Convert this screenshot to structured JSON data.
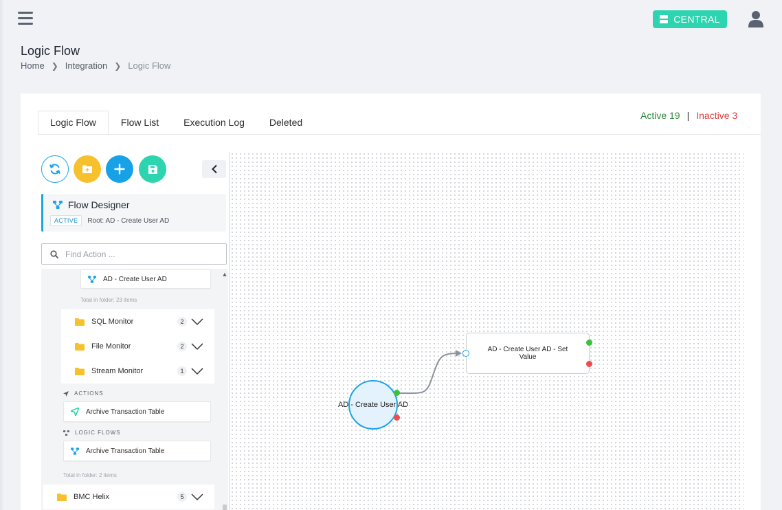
{
  "topbar": {
    "menu_icon": "hamburger-icon",
    "central_label": "CENTRAL",
    "central_icon": "server-icon",
    "user_icon": "user-icon"
  },
  "page": {
    "title": "Logic Flow",
    "breadcrumb": [
      "Home",
      "Integration",
      "Logic Flow"
    ]
  },
  "tabs": [
    {
      "label": "Logic Flow",
      "active": true
    },
    {
      "label": "Flow List",
      "active": false
    },
    {
      "label": "Execution Log",
      "active": false
    },
    {
      "label": "Deleted",
      "active": false
    }
  ],
  "status": {
    "active": "Active 19",
    "separator": "|",
    "inactive": "Inactive 3"
  },
  "toolbar": {
    "icons": [
      "refresh-icon",
      "folder-plus-icon",
      "plus-icon",
      "save-icon"
    ],
    "collapse_icon": "chevron-left-icon"
  },
  "designer": {
    "title": "Flow Designer",
    "badge": "ACTIVE",
    "root": "Root: AD - Create User AD"
  },
  "search": {
    "placeholder": "Find Action ..."
  },
  "tree": {
    "top_item": "AD - Create User AD",
    "top_total": "Total in folder: 23 items",
    "folders": [
      {
        "name": "SQL Monitor",
        "count": "2"
      },
      {
        "name": "File Monitor",
        "count": "2"
      },
      {
        "name": "Stream Monitor",
        "count": "1"
      }
    ],
    "actions_label": "ACTIONS",
    "action_item": "Archive Transaction Table",
    "logic_flows_label": "LOGIC FLOWS",
    "logic_flow_item": "Archive Transaction Table",
    "bottom_total": "Total in folder: 2 items",
    "bottom_folder": {
      "name": "BMC Helix",
      "count": "5"
    }
  },
  "canvas": {
    "start_node": "AD - Create User AD",
    "next_node": "AD - Create User AD - Set Value"
  },
  "colors": {
    "accent": "#1aa5e6",
    "teal": "#2dd4b0",
    "yellow": "#f7c12e",
    "active": "#2e8b3a",
    "inactive": "#e03a3a"
  }
}
